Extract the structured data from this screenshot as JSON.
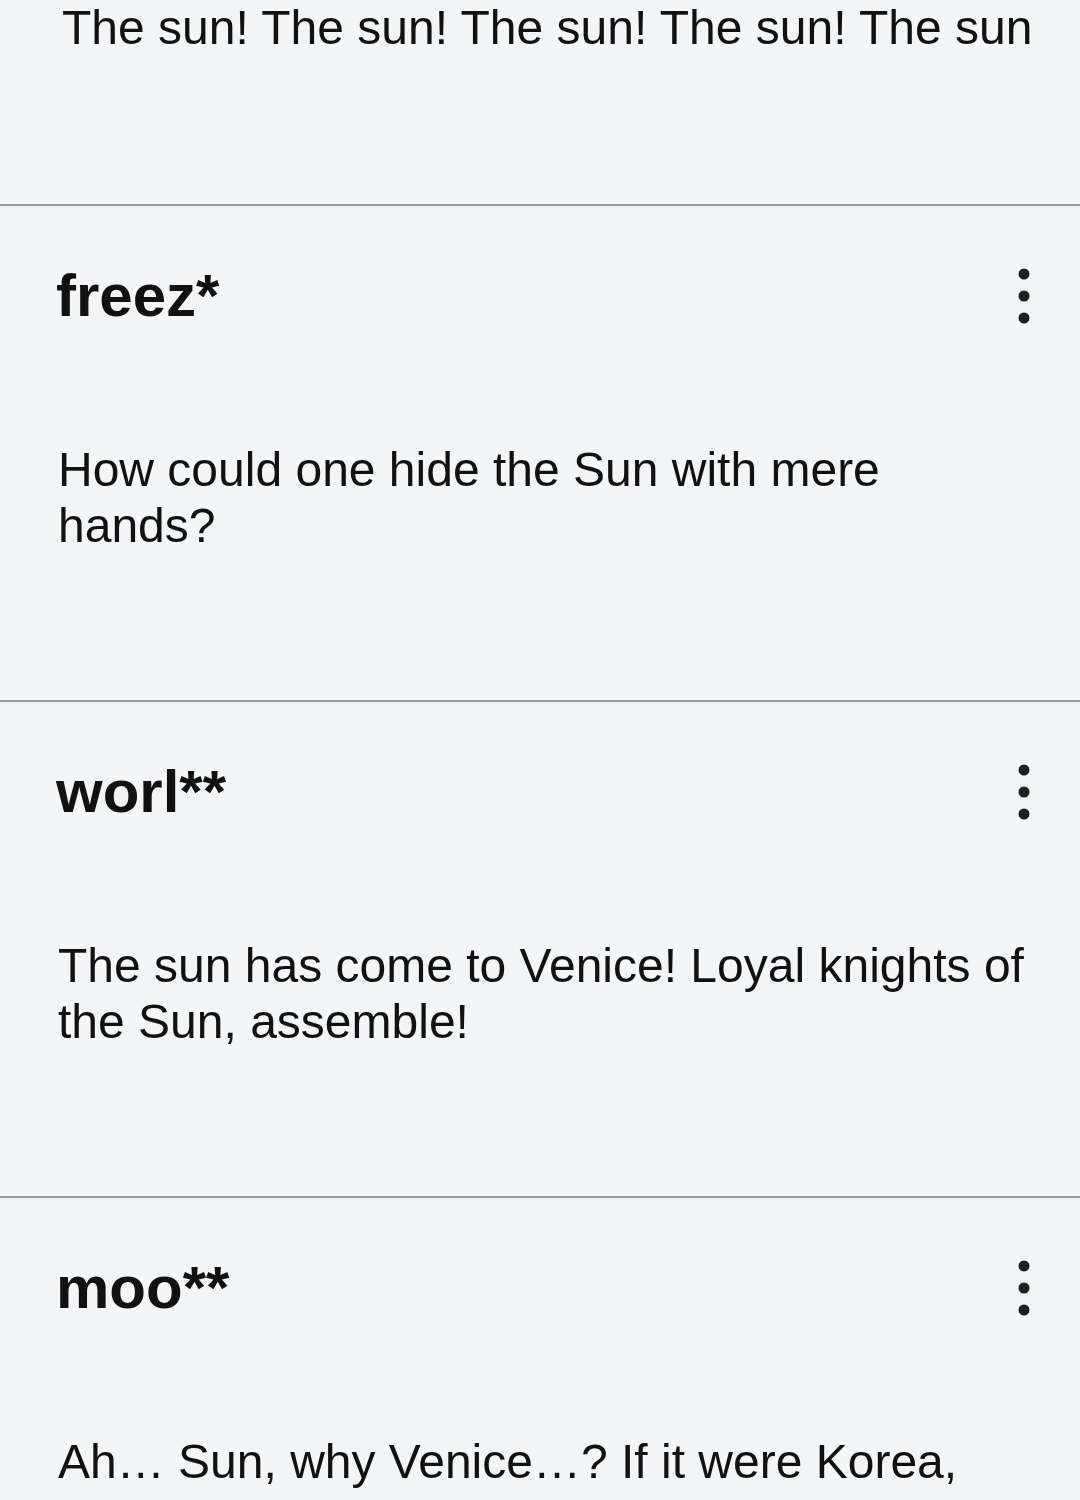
{
  "previous_comment": {
    "text": "The sun! The sun! The sun! The sun! The sun"
  },
  "comments": [
    {
      "username": "freez*",
      "text": "How could one hide the Sun with mere hands?"
    },
    {
      "username": "worl**",
      "text": "The sun has come to Venice! Loyal knights of the Sun, assemble!"
    },
    {
      "username": "moo**",
      "text": "Ah… Sun, why Venice…? If it were Korea,"
    }
  ]
}
